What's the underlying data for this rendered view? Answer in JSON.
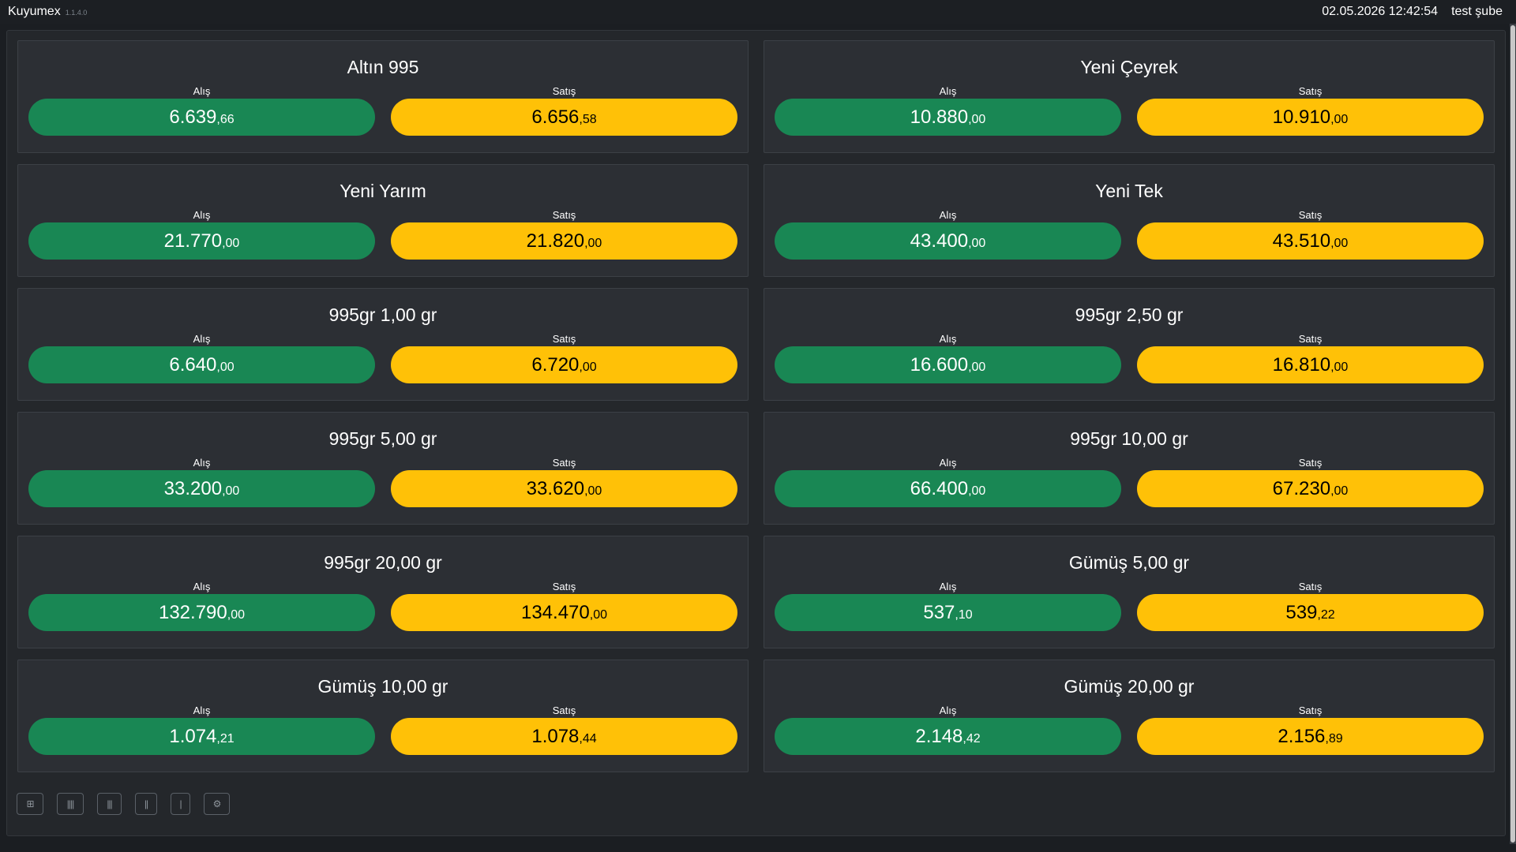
{
  "app": {
    "name": "Kuyumex",
    "version": "1.1.4.0"
  },
  "header": {
    "datetime": "02.05.2026 12:42:54",
    "branch": "test şube"
  },
  "labels": {
    "buy": "Alış",
    "sell": "Satış"
  },
  "colors": {
    "buy": "#198754",
    "sell": "#ffc107",
    "card": "#2c2f34",
    "background": "#1b1e22"
  },
  "cards": [
    {
      "title": "Altın 995",
      "buy_int": "6.639",
      "buy_dec": "66",
      "sell_int": "6.656",
      "sell_dec": "58"
    },
    {
      "title": "Yeni Çeyrek",
      "buy_int": "10.880",
      "buy_dec": "00",
      "sell_int": "10.910",
      "sell_dec": "00"
    },
    {
      "title": "Yeni Yarım",
      "buy_int": "21.770",
      "buy_dec": "00",
      "sell_int": "21.820",
      "sell_dec": "00"
    },
    {
      "title": "Yeni Tek",
      "buy_int": "43.400",
      "buy_dec": "00",
      "sell_int": "43.510",
      "sell_dec": "00"
    },
    {
      "title": "995gr 1,00 gr",
      "buy_int": "6.640",
      "buy_dec": "00",
      "sell_int": "6.720",
      "sell_dec": "00"
    },
    {
      "title": "995gr 2,50 gr",
      "buy_int": "16.600",
      "buy_dec": "00",
      "sell_int": "16.810",
      "sell_dec": "00"
    },
    {
      "title": "995gr 5,00 gr",
      "buy_int": "33.200",
      "buy_dec": "00",
      "sell_int": "33.620",
      "sell_dec": "00"
    },
    {
      "title": "995gr 10,00 gr",
      "buy_int": "66.400",
      "buy_dec": "00",
      "sell_int": "67.230",
      "sell_dec": "00"
    },
    {
      "title": "995gr 20,00 gr",
      "buy_int": "132.790",
      "buy_dec": "00",
      "sell_int": "134.470",
      "sell_dec": "00"
    },
    {
      "title": "Gümüş 5,00 gr",
      "buy_int": "537",
      "buy_dec": "10",
      "sell_int": "539",
      "sell_dec": "22"
    },
    {
      "title": "Gümüş 10,00 gr",
      "buy_int": "1.074",
      "buy_dec": "21",
      "sell_int": "1.078",
      "sell_dec": "44"
    },
    {
      "title": "Gümüş 20,00 gr",
      "buy_int": "2.148",
      "buy_dec": "42",
      "sell_int": "2.156",
      "sell_dec": "89"
    }
  ],
  "toolbar": [
    {
      "name": "layout-grid-button",
      "icon": "grid-icon",
      "glyph": "⊞"
    },
    {
      "name": "layout-4-columns-button",
      "icon": "four-columns-icon",
      "glyph": "||||"
    },
    {
      "name": "layout-3-columns-button",
      "icon": "three-columns-icon",
      "glyph": "|||"
    },
    {
      "name": "layout-2-columns-button",
      "icon": "two-columns-icon",
      "glyph": "||"
    },
    {
      "name": "layout-1-column-button",
      "icon": "one-column-icon",
      "glyph": "|"
    },
    {
      "name": "settings-button",
      "icon": "gear-icon",
      "glyph": "⚙"
    }
  ]
}
